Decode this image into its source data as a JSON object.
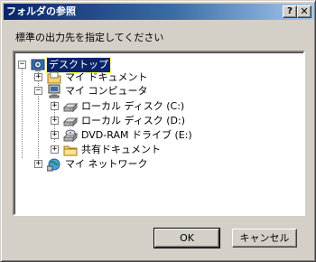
{
  "window": {
    "title": "フォルダの参照",
    "help_label": "?",
    "close_label": "✕"
  },
  "prompt": "標準の出力先を指定してください",
  "tree": {
    "items": [
      {
        "label": "デスクトップ",
        "expander": "⊟",
        "icon": "desktop-icon",
        "selected": true
      },
      {
        "label": "マイ ドキュメント",
        "expander": "+",
        "icon": "my-documents-icon"
      },
      {
        "label": "マイ コンピュータ",
        "expander": "−",
        "icon": "my-computer-icon"
      },
      {
        "label": "ローカル ディスク (C:)",
        "expander": "+",
        "icon": "hard-disk-icon"
      },
      {
        "label": "ローカル ディスク (D:)",
        "expander": "+",
        "icon": "hard-disk-icon"
      },
      {
        "label": "DVD-RAM ドライブ (E:)",
        "expander": "+",
        "icon": "dvd-drive-icon"
      },
      {
        "label": "共有ドキュメント",
        "expander": "+",
        "icon": "shared-folder-icon"
      },
      {
        "label": "マイ ネットワーク",
        "expander": "+",
        "icon": "my-network-icon"
      }
    ]
  },
  "buttons": {
    "ok": "OK",
    "cancel": "キャンセル"
  },
  "colors": {
    "titlebar_start": "#0a246a",
    "titlebar_end": "#a6caf0",
    "selection": "#0a246a",
    "face": "#d4d0c8"
  }
}
